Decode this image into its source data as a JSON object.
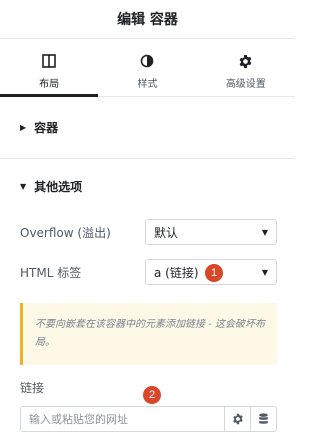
{
  "header": {
    "title": "编辑 容器"
  },
  "tabs": [
    {
      "label": "布局",
      "icon": "layout-icon",
      "active": true
    },
    {
      "label": "样式",
      "icon": "half-circle-icon",
      "active": false
    },
    {
      "label": "高级设置",
      "icon": "gear-icon",
      "active": false
    }
  ],
  "sections": {
    "container": {
      "title": "容器",
      "expanded": false
    },
    "other": {
      "title": "其他选项",
      "expanded": true
    }
  },
  "overflow": {
    "label": "Overflow (溢出)",
    "value": "默认"
  },
  "html_tag": {
    "label": "HTML 标签",
    "value": "a (链接)"
  },
  "notice": {
    "text": "不要向嵌套在该容器中的元素添加链接 - 这会破坏布局。"
  },
  "link": {
    "label": "链接",
    "placeholder": "输入或粘贴您的网址"
  },
  "badges": {
    "first": "1",
    "second": "2"
  },
  "colors": {
    "accent": "#d9472b",
    "notice_border": "#f0b323",
    "notice_bg": "#fef8e6"
  }
}
